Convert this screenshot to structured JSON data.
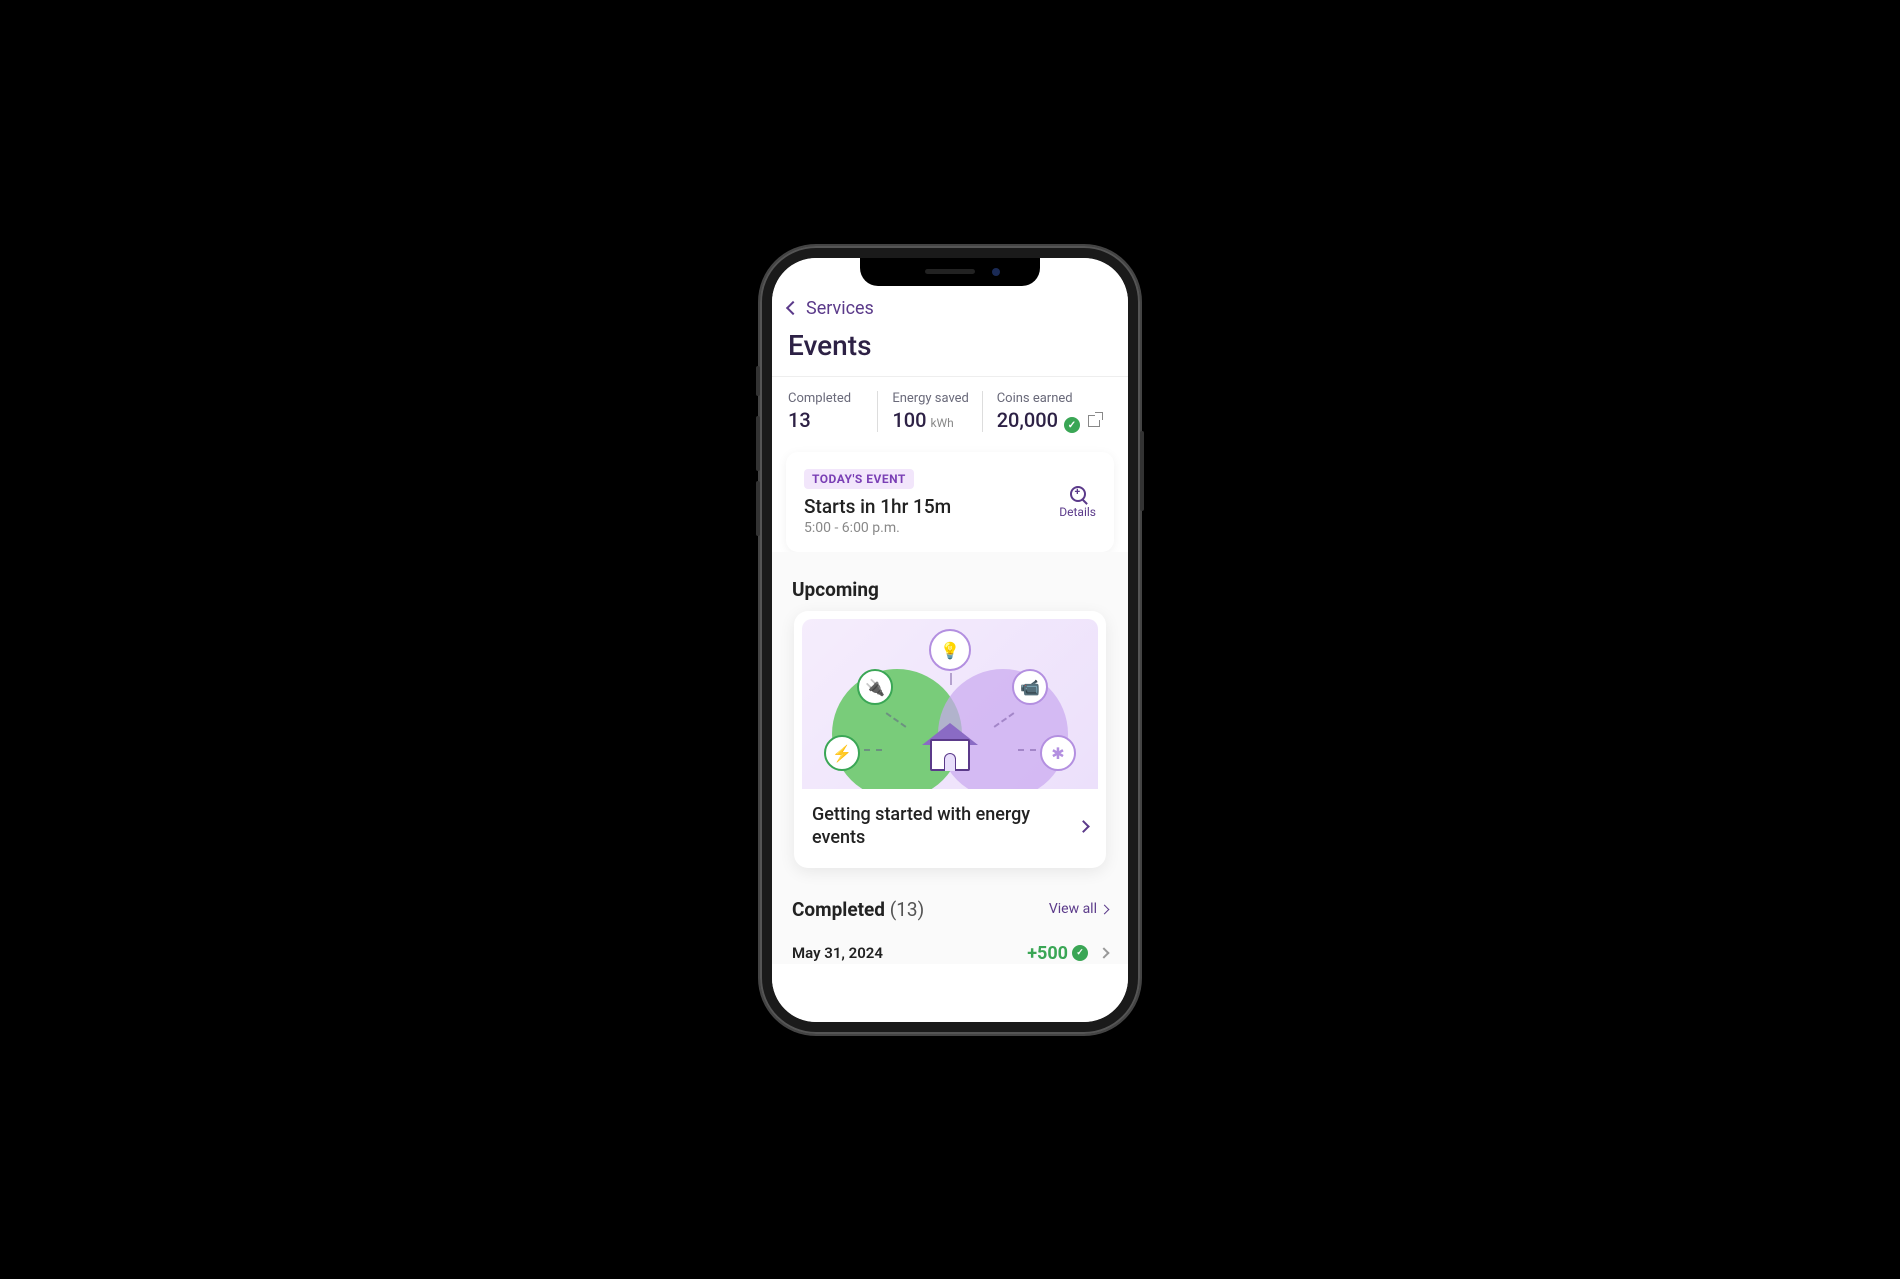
{
  "nav": {
    "back_label": "Services"
  },
  "page": {
    "title": "Events"
  },
  "stats": {
    "completed": {
      "label": "Completed",
      "value": "13"
    },
    "energy": {
      "label": "Energy saved",
      "value": "100",
      "unit": "kWh"
    },
    "coins": {
      "label": "Coins earned",
      "value": "20,000"
    }
  },
  "today": {
    "badge": "TODAY'S EVENT",
    "title": "Starts in 1hr 15m",
    "time": "5:00 - 6:00 p.m.",
    "details_label": "Details"
  },
  "upcoming": {
    "heading": "Upcoming",
    "card_title": "Getting started with energy events"
  },
  "completed": {
    "heading": "Completed",
    "count": "(13)",
    "view_all": "View all",
    "items": [
      {
        "date": "May 31, 2024",
        "reward": "+500"
      }
    ]
  }
}
